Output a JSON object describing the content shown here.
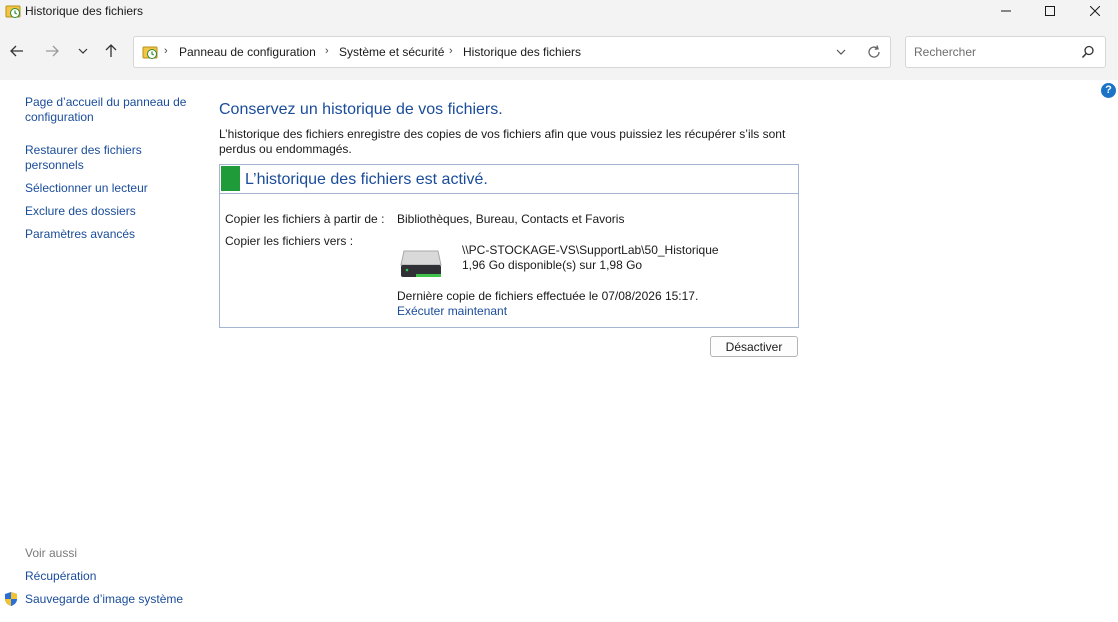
{
  "window": {
    "title": "Historique des fichiers"
  },
  "breadcrumb": [
    "Panneau de configuration",
    "Système et sécurité",
    "Historique des fichiers"
  ],
  "search": {
    "placeholder": "Rechercher"
  },
  "help_label": "?",
  "sidebar": {
    "items": [
      {
        "label": "Page d’accueil du panneau de configuration"
      },
      {
        "label": "Restaurer des fichiers personnels"
      },
      {
        "label": "Sélectionner un lecteur"
      },
      {
        "label": "Exclure des dossiers"
      },
      {
        "label": "Paramètres avancés"
      }
    ],
    "see_also_label": "Voir aussi",
    "see_also": [
      {
        "label": "Récupération"
      },
      {
        "label": "Sauvegarde d’image système"
      }
    ]
  },
  "main": {
    "heading": "Conservez un historique de vos fichiers.",
    "description": "L’historique des fichiers enregistre des copies de vos fichiers afin que vous puissiez les récupérer s’ils sont perdus ou endommagés.",
    "status": {
      "title": "L’historique des fichiers est activé.",
      "status_color": "#1f9b3a",
      "copy_from_label": "Copier les fichiers à partir de :",
      "copy_from_value": "Bibliothèques, Bureau, Contacts et Favoris",
      "copy_to_label": "Copier les fichiers vers :",
      "drive_path": "\\\\PC-STOCKAGE-VS\\SupportLab\\50_Historique",
      "drive_space": "1,96 Go disponible(s) sur 1,98 Go",
      "last_copy": "Dernière copie de fichiers effectuée le 07/08/2026 15:17.",
      "run_now": "Exécuter maintenant"
    },
    "deactivate_button": "Désactiver"
  },
  "colors": {
    "link": "#1a4c9a",
    "accent_blue": "#1a73c7",
    "panel_border": "#a5b5d1"
  }
}
